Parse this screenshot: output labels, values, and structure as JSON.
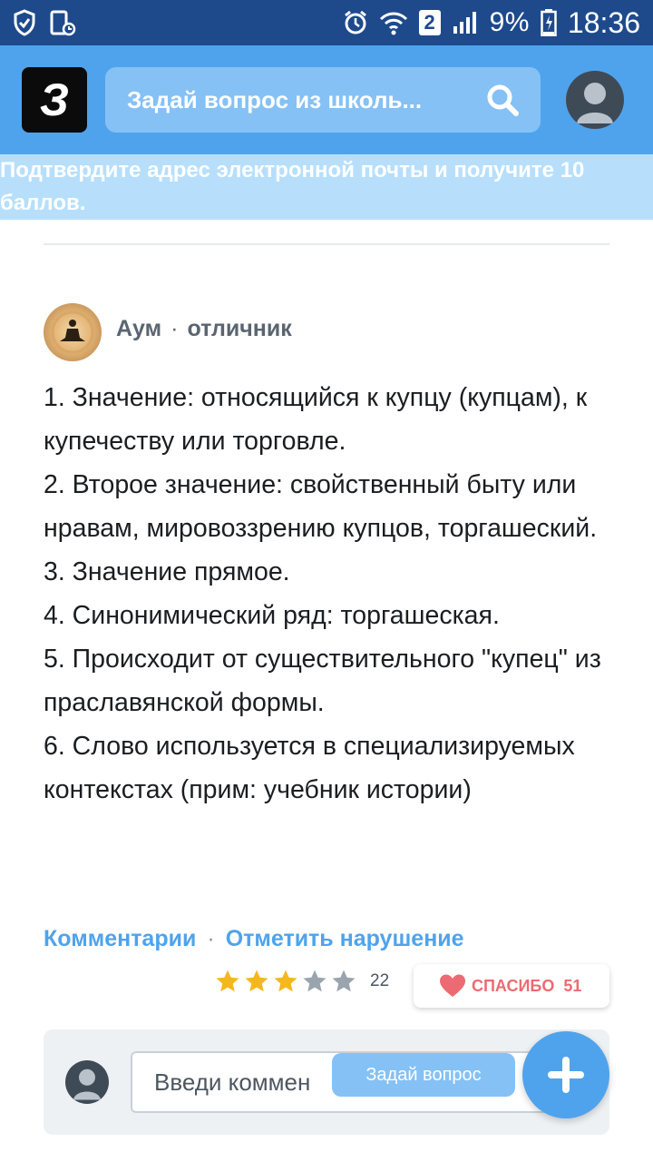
{
  "status_bar": {
    "sim_slot": "2",
    "battery": "9%",
    "time": "18:36",
    "icons": [
      "shield-icon",
      "screen-icon",
      "alarm-icon",
      "wifi-icon",
      "signal-icon",
      "battery-icon"
    ]
  },
  "header": {
    "logo_letter": "З",
    "search_placeholder": "Задай вопрос из школь...",
    "colors": {
      "bar": "#4fa3ec",
      "status": "#1e4a8c"
    }
  },
  "banner": {
    "text": "Подтвердите адрес электронной почты и получите 10 баллов."
  },
  "answer": {
    "author": "Аум",
    "separator": "·",
    "rank": "отличник",
    "lines": [
      "1. Значение: относящийся к купцу (купцам), к купечеству или торговле.",
      "2. Второе значение: свойственный быту или нравам, мировоззрению купцов, торгашеский.",
      "3. Значение прямое.",
      "4. Синонимический ряд: торгашеская.",
      "5. Происходит от существительного \"купец\" из праславянской формы.",
      "6. Слово используется в специализируемых контекстах (прим: учебник истории)"
    ],
    "actions": {
      "comments": "Комментарии",
      "separator": "·",
      "report": "Отметить нарушение"
    },
    "rating": {
      "stars_filled": 3,
      "stars_total": 5,
      "count": "22"
    },
    "thanks": {
      "label": "СПАСИБО",
      "count": "51"
    }
  },
  "comment": {
    "placeholder": "Введи коммен"
  },
  "ask_button": {
    "label": "Задай вопрос"
  },
  "fab": {
    "icon": "plus-icon"
  }
}
